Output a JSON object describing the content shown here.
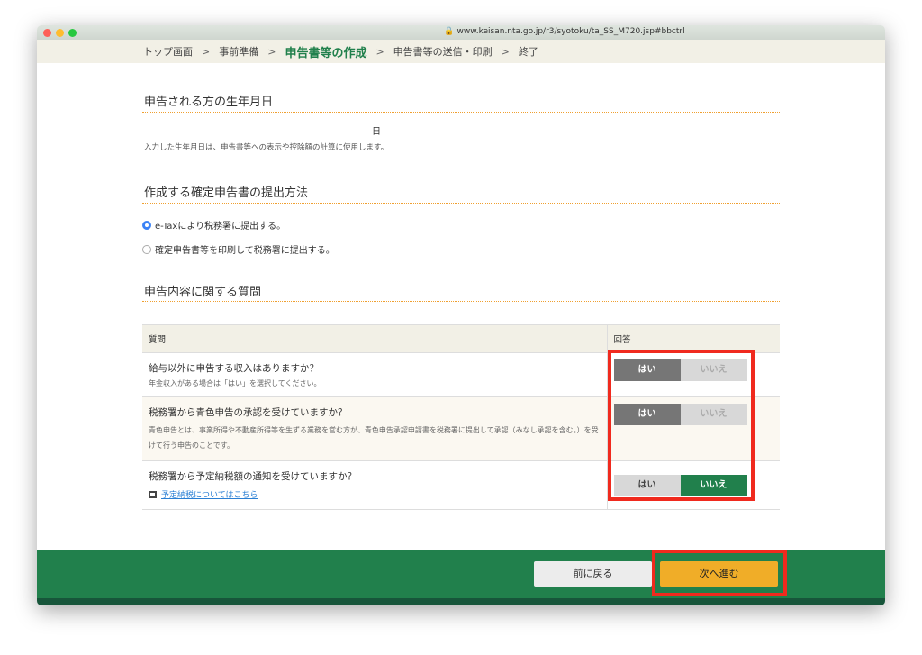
{
  "browser": {
    "url": "www.keisan.nta.go.jp/r3/syotoku/ta_SS_M720.jsp#bbctrl"
  },
  "breadcrumb": [
    "トップ画面",
    "事前準備",
    "申告書等の作成",
    "申告書等の送信・印刷",
    "終了"
  ],
  "breadcrumb_sep": ">",
  "birth": {
    "heading": "申告される方の生年月日",
    "day_label": "日",
    "note": "入力した生年月日は、申告書等への表示や控除額の計算に使用します。"
  },
  "method": {
    "heading": "作成する確定申告書の提出方法",
    "options": [
      "e-Taxにより税務署に提出する。",
      "確定申告書等を印刷して税務署に提出する。"
    ],
    "selected": 0
  },
  "questions": {
    "heading": "申告内容に関する質問",
    "col_question": "質問",
    "col_answer": "回答",
    "rows": [
      {
        "q": "給与以外に申告する収入はありますか？",
        "sub": "年金収入がある場合は「はい」を選択してください。",
        "yes": "はい",
        "no": "いいえ",
        "answer": "はい"
      },
      {
        "q": "税務署から青色申告の承認を受けていますか？",
        "sub": "青色申告とは、事業所得や不動産所得等を生ずる業務を営む方が、青色申告承認申請書を税務署に提出して承認（みなし承認を含む。）を受けて行う申告のことです。",
        "yes": "はい",
        "no": "いいえ",
        "answer": "はい"
      },
      {
        "q": "税務署から予定納税額の通知を受けていますか？",
        "link": "予定納税についてはこちら",
        "yes": "はい",
        "no": "いいえ",
        "answer": "いいえ"
      }
    ]
  },
  "footer": {
    "back": "前に戻る",
    "next": "次へ進む"
  },
  "colors": {
    "brand_green": "#21804c",
    "next_button": "#f0ad28",
    "highlight": "#f02a1e"
  }
}
